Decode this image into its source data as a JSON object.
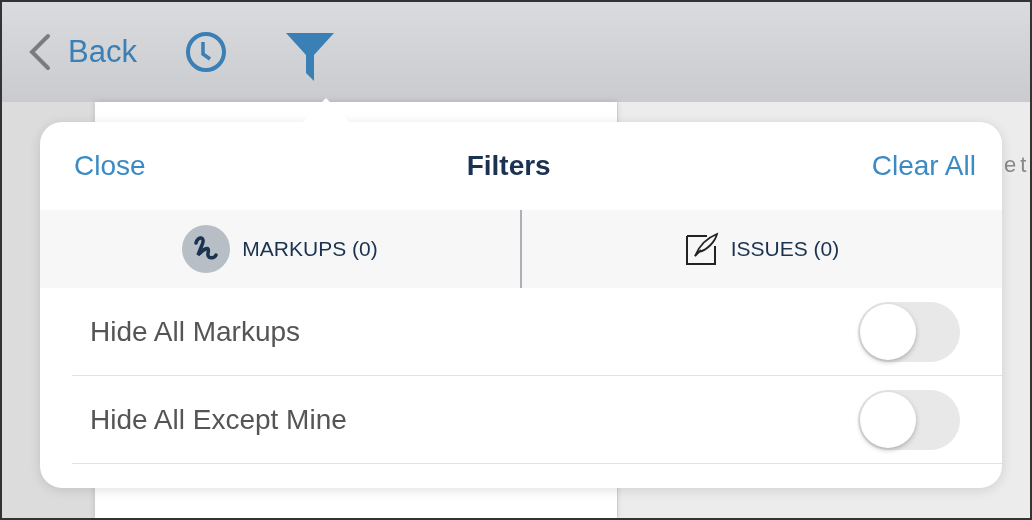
{
  "toolbar": {
    "back_label": "Back",
    "filter_active": true
  },
  "background_text": "e t",
  "popover": {
    "close": "Close",
    "title": "Filters",
    "clear_all": "Clear All",
    "tabs": [
      {
        "label": "MARKUPS (0)",
        "kind": "markups"
      },
      {
        "label": "ISSUES (0)",
        "kind": "issues"
      }
    ],
    "options": [
      {
        "label": "Hide All Markups",
        "on": false
      },
      {
        "label": "Hide All Except Mine",
        "on": false
      }
    ]
  }
}
